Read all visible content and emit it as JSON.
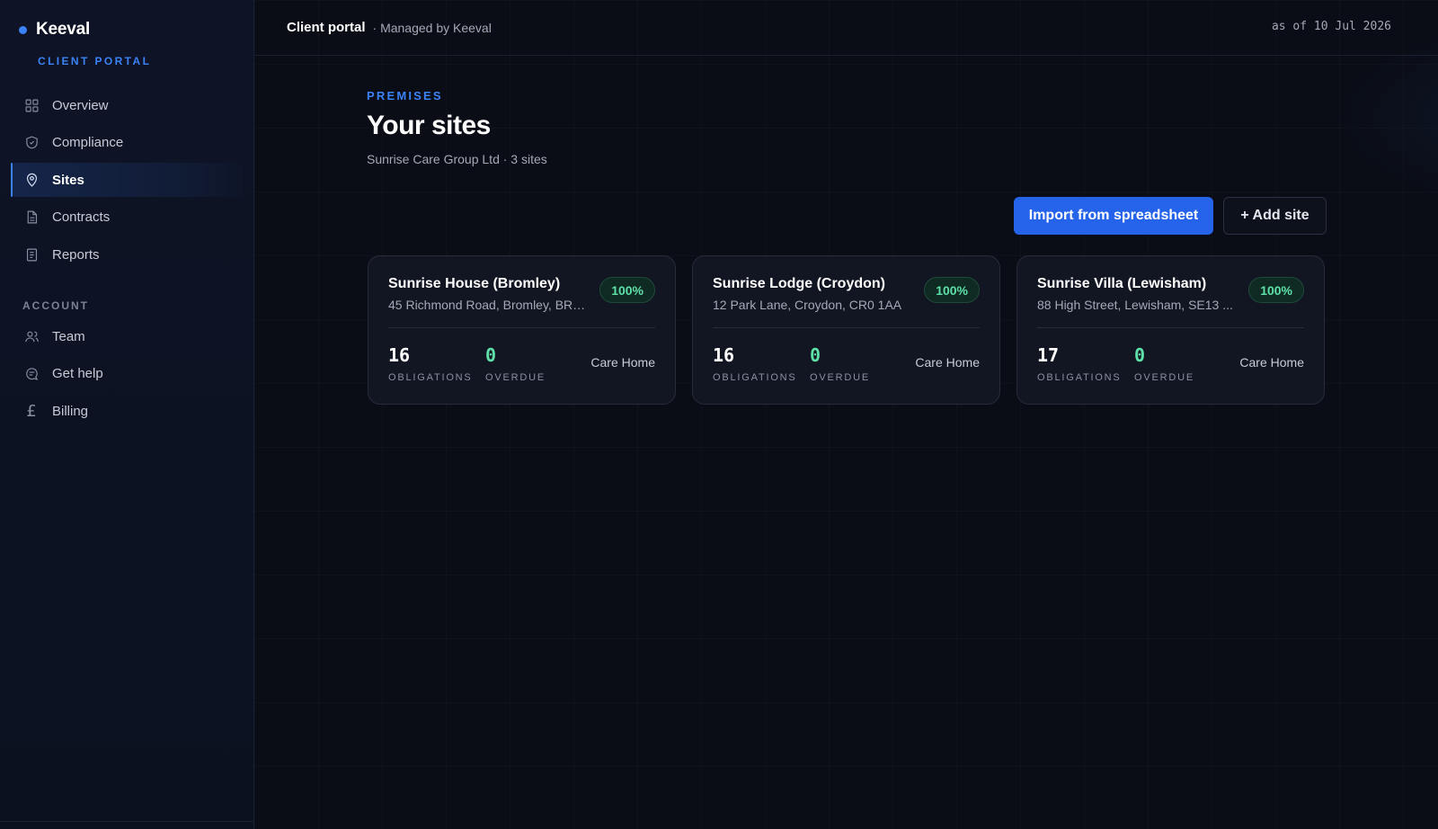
{
  "brand": {
    "name": "Keeval",
    "subtitle": "CLIENT PORTAL"
  },
  "nav": [
    {
      "label": "Overview",
      "icon": "grid-icon",
      "active": false
    },
    {
      "label": "Compliance",
      "icon": "shield-icon",
      "active": false
    },
    {
      "label": "Sites",
      "icon": "map-pin-icon",
      "active": true
    },
    {
      "label": "Contracts",
      "icon": "document-icon",
      "active": false
    },
    {
      "label": "Reports",
      "icon": "report-icon",
      "active": false
    }
  ],
  "account_label": "ACCOUNT",
  "account_nav": [
    {
      "label": "Team",
      "icon": "users-icon"
    },
    {
      "label": "Get help",
      "icon": "help-icon"
    },
    {
      "label": "Billing",
      "icon": "pound-icon"
    }
  ],
  "topbar": {
    "title": "Client portal",
    "subtitle": "· Managed by Keeval",
    "date": "as of 10 Jul 2026"
  },
  "page": {
    "eyebrow": "PREMISES",
    "title": "Your sites",
    "subtitle": "Sunrise Care Group Ltd · 3 sites",
    "import_label": "Import from spreadsheet",
    "add_label": "+ Add site"
  },
  "stat_labels": {
    "obligations": "OBLIGATIONS",
    "overdue": "OVERDUE"
  },
  "sites": [
    {
      "name": "Sunrise House (Bromley)",
      "address": "45 Richmond Road, Bromley, BR1...",
      "score": "100%",
      "obligations": "16",
      "overdue": "0",
      "type": "Care Home"
    },
    {
      "name": "Sunrise Lodge (Croydon)",
      "address": "12 Park Lane, Croydon, CR0 1AA",
      "score": "100%",
      "obligations": "16",
      "overdue": "0",
      "type": "Care Home"
    },
    {
      "name": "Sunrise Villa (Lewisham)",
      "address": "88 High Street, Lewisham, SE13 ...",
      "score": "100%",
      "obligations": "17",
      "overdue": "0",
      "type": "Care Home"
    }
  ],
  "colors": {
    "accent": "#3b82f6",
    "primary_button": "#2563eb",
    "success": "#5ee0a8",
    "background": "#0a0d16"
  }
}
